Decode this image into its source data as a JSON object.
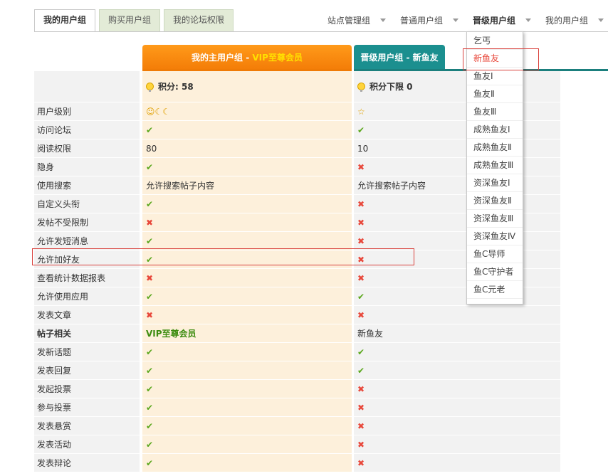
{
  "tabs": [
    {
      "label": "我的用户组"
    },
    {
      "label": "购买用户组"
    },
    {
      "label": "我的论坛权限"
    }
  ],
  "nav": [
    {
      "label": "站点管理组"
    },
    {
      "label": "普通用户组"
    },
    {
      "label": "晋级用户组"
    },
    {
      "label": "我的用户组"
    }
  ],
  "columns": {
    "main_prefix": "我的主用户组 - ",
    "main_group": "VIP至尊会员",
    "second": "晋级用户组 - 新鱼友"
  },
  "score": {
    "main": "积分: 58",
    "second": "积分下限 0"
  },
  "rows": [
    {
      "label": "用户级别",
      "main": "☺☾☾",
      "second": "☆"
    },
    {
      "label": "访问论坛",
      "main": "✔",
      "second": "✔"
    },
    {
      "label": "阅读权限",
      "main": "80",
      "second": "10"
    },
    {
      "label": "隐身",
      "main": "✔",
      "second": "✖"
    },
    {
      "label": "使用搜索",
      "main": "允许搜索帖子内容",
      "second": "允许搜索帖子内容"
    },
    {
      "label": "自定义头衔",
      "main": "✔",
      "second": "✖"
    },
    {
      "label": "发帖不受限制",
      "main": "✖",
      "second": "✖"
    },
    {
      "label": "允许发短消息",
      "main": "✔",
      "second": "✖"
    },
    {
      "label": "允许加好友",
      "main": "✔",
      "second": "✖"
    },
    {
      "label": "查看统计数据报表",
      "main": "✖",
      "second": "✖"
    },
    {
      "label": "允许使用应用",
      "main": "✔",
      "second": "✔"
    },
    {
      "label": "发表文章",
      "main": "✖",
      "second": "✖"
    },
    {
      "label": "帖子相关",
      "main": "VIP至尊会员",
      "second": "新鱼友"
    },
    {
      "label": "发新话题",
      "main": "✔",
      "second": "✔"
    },
    {
      "label": "发表回复",
      "main": "✔",
      "second": "✔"
    },
    {
      "label": "发起投票",
      "main": "✔",
      "second": "✖"
    },
    {
      "label": "参与投票",
      "main": "✔",
      "second": "✖"
    },
    {
      "label": "发表悬赏",
      "main": "✔",
      "second": "✖"
    },
    {
      "label": "发表活动",
      "main": "✔",
      "second": "✖"
    },
    {
      "label": "发表辩论",
      "main": "✔",
      "second": "✖"
    }
  ],
  "dropdown": [
    {
      "label": "乞丐"
    },
    {
      "label": "新鱼友"
    },
    {
      "label": "鱼友Ⅰ"
    },
    {
      "label": "鱼友Ⅱ"
    },
    {
      "label": "鱼友Ⅲ"
    },
    {
      "label": "成熟鱼友Ⅰ"
    },
    {
      "label": "成熟鱼友Ⅱ"
    },
    {
      "label": "成熟鱼友Ⅲ"
    },
    {
      "label": "资深鱼友Ⅰ"
    },
    {
      "label": "资深鱼友Ⅱ"
    },
    {
      "label": "资深鱼友Ⅲ"
    },
    {
      "label": "资深鱼友Ⅳ"
    },
    {
      "label": "鱼C导师"
    },
    {
      "label": "鱼C守护者"
    },
    {
      "label": "鱼C元老"
    }
  ],
  "colors": {
    "accent": "#f37b06",
    "teal": "#1b8f8f",
    "ok": "#5aa71c",
    "no": "#e8483b"
  }
}
